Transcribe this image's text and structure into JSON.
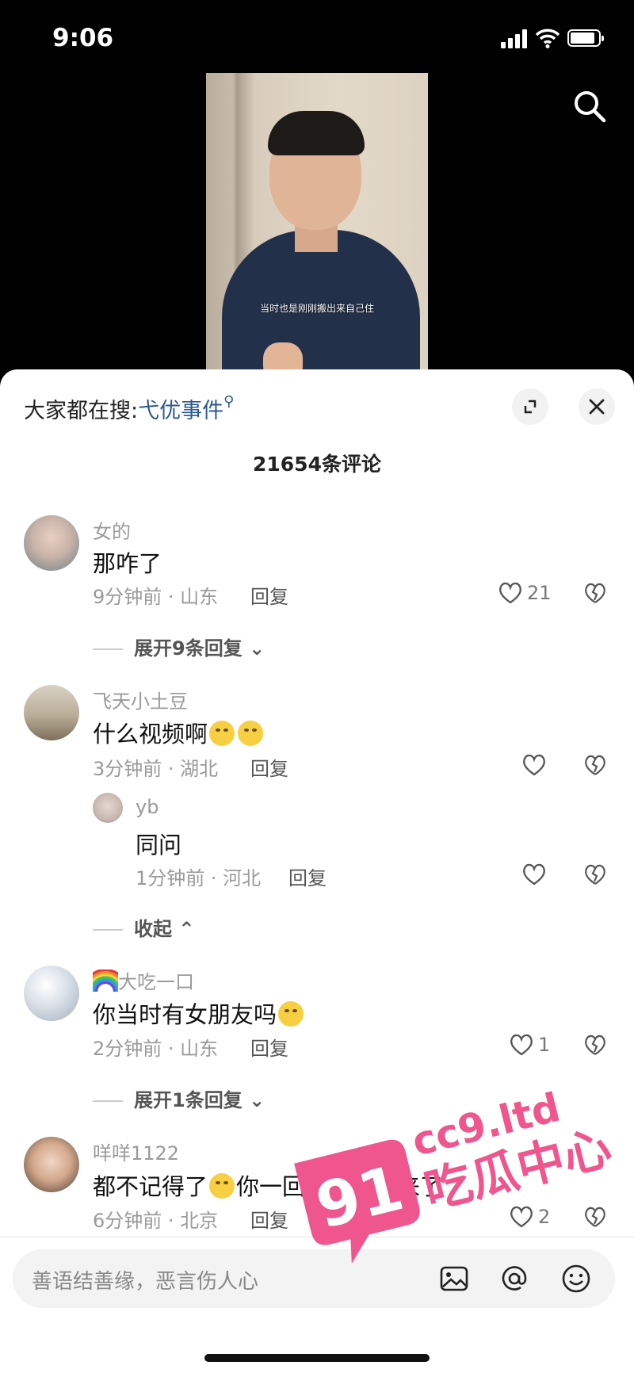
{
  "status": {
    "time": "9:06"
  },
  "video": {
    "subtitle": "当时也是刚刚搬出来自己住"
  },
  "sheet": {
    "search_prefix": "大家都在搜:",
    "search_term": "弋优事件",
    "comment_count": "21654条评论"
  },
  "comments": [
    {
      "user": "女的",
      "text": "那咋了",
      "time": "9分钟前",
      "location": "山东",
      "reply": "回复",
      "likes": "21",
      "expand": "展开9条回复"
    },
    {
      "user": "飞天小土豆",
      "text": "什么视频啊",
      "time": "3分钟前",
      "location": "湖北",
      "reply": "回复",
      "likes": ""
    },
    {
      "user": "yb",
      "text": "同问",
      "time": "1分钟前",
      "location": "河北",
      "reply": "回复",
      "likes": "",
      "collapse": "收起"
    },
    {
      "user": "大吃一口",
      "text": "你当时有女朋友吗",
      "time": "2分钟前",
      "location": "山东",
      "reply": "回复",
      "likes": "1",
      "expand": "展开1条回复"
    },
    {
      "user": "咩咩1122",
      "text_a": "都不记得了",
      "text_b": "你一回应又想起来了",
      "time": "6分钟前",
      "location": "北京",
      "reply": "回复",
      "likes": "2"
    }
  ],
  "input": {
    "placeholder": "善语结善缘，恶言伤人心"
  },
  "watermark": {
    "number": "91",
    "domain": "cc9.ltd",
    "title": "吃瓜中心"
  },
  "colors": {
    "accent_link": "#2b5a8e",
    "watermark": "#f0568e"
  }
}
